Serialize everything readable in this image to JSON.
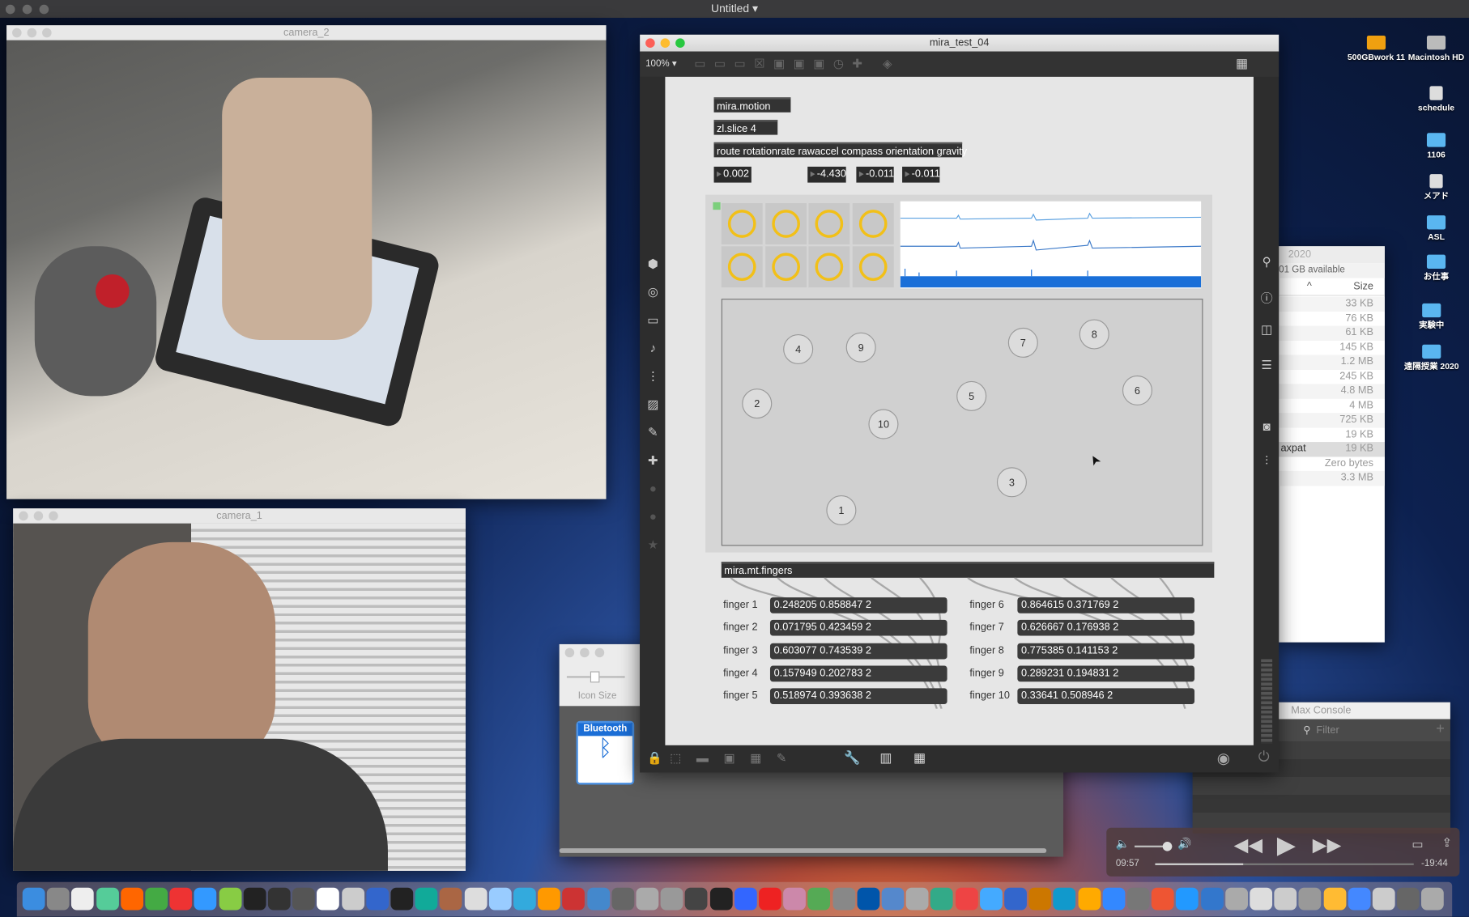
{
  "menubar": {
    "title": "Untitled"
  },
  "camera2": {
    "title": "camera_2"
  },
  "camera1": {
    "title": "camera_1"
  },
  "max_window": {
    "title": "mira_test_04",
    "zoom": "100%",
    "objects": {
      "motion": "mira.motion",
      "slice": "zl.slice 4",
      "route": "route rotationrate rawaccel compass orientation gravity",
      "fingers_obj": "mira.mt.fingers"
    },
    "numbers": [
      "0.002",
      "-4.430",
      "-0.011",
      "-0.011"
    ],
    "touch_points": [
      {
        "label": "1"
      },
      {
        "label": "2"
      },
      {
        "label": "3"
      },
      {
        "label": "4"
      },
      {
        "label": "5"
      },
      {
        "label": "6"
      },
      {
        "label": "7"
      },
      {
        "label": "8"
      },
      {
        "label": "9"
      },
      {
        "label": "10"
      }
    ],
    "fingers": [
      {
        "label": "finger 1",
        "value": "0.248205 0.858847 2"
      },
      {
        "label": "finger 2",
        "value": "0.071795 0.423459 2"
      },
      {
        "label": "finger 3",
        "value": "0.603077 0.743539 2"
      },
      {
        "label": "finger 4",
        "value": "0.157949 0.202783 2"
      },
      {
        "label": "finger 5",
        "value": "0.518974 0.393638 2"
      },
      {
        "label": "finger 6",
        "value": "0.864615 0.371769 2"
      },
      {
        "label": "finger 7",
        "value": "0.626667 0.176938 2"
      },
      {
        "label": "finger 8",
        "value": "0.775385 0.141153 2"
      },
      {
        "label": "finger 9",
        "value": "0.289231 0.194831 2"
      },
      {
        "label": "finger 10",
        "value": "0.33641 0.508946 2"
      }
    ],
    "colors": {
      "ring": "#f2c018",
      "wave": "#1a6fd8"
    }
  },
  "finder": {
    "title": "2020",
    "available": "01 GB available",
    "size_header": "Size",
    "row_name": "axpat",
    "sizes": [
      "33 KB",
      "76 KB",
      "61 KB",
      "145 KB",
      "1.2 MB",
      "245 KB",
      "4.8 MB",
      "4 MB",
      "725 KB",
      "19 KB",
      "19 KB",
      "Zero bytes",
      "3.3 MB"
    ]
  },
  "console": {
    "title": "Max Console",
    "filter_placeholder": "Filter"
  },
  "prefs": {
    "icon_size": "Icon Size",
    "bluetooth": "Bluetooth"
  },
  "player": {
    "elapsed": "09:57",
    "remaining": "-19:44",
    "progress": 0.34,
    "volume": 0.8
  },
  "desktop": [
    {
      "label": "500GBwork 11",
      "type": "drive"
    },
    {
      "label": "Macintosh HD",
      "type": "disk"
    },
    {
      "label": "schedule",
      "type": "doc"
    },
    {
      "label": "1106",
      "type": "folder"
    },
    {
      "label": "メアド",
      "type": "doc"
    },
    {
      "label": "ASL",
      "type": "folder"
    },
    {
      "label": "お仕事",
      "type": "folder"
    },
    {
      "label": "実験中",
      "type": "folder"
    },
    {
      "label": "遠隔授業 2020",
      "type": "folder"
    }
  ]
}
